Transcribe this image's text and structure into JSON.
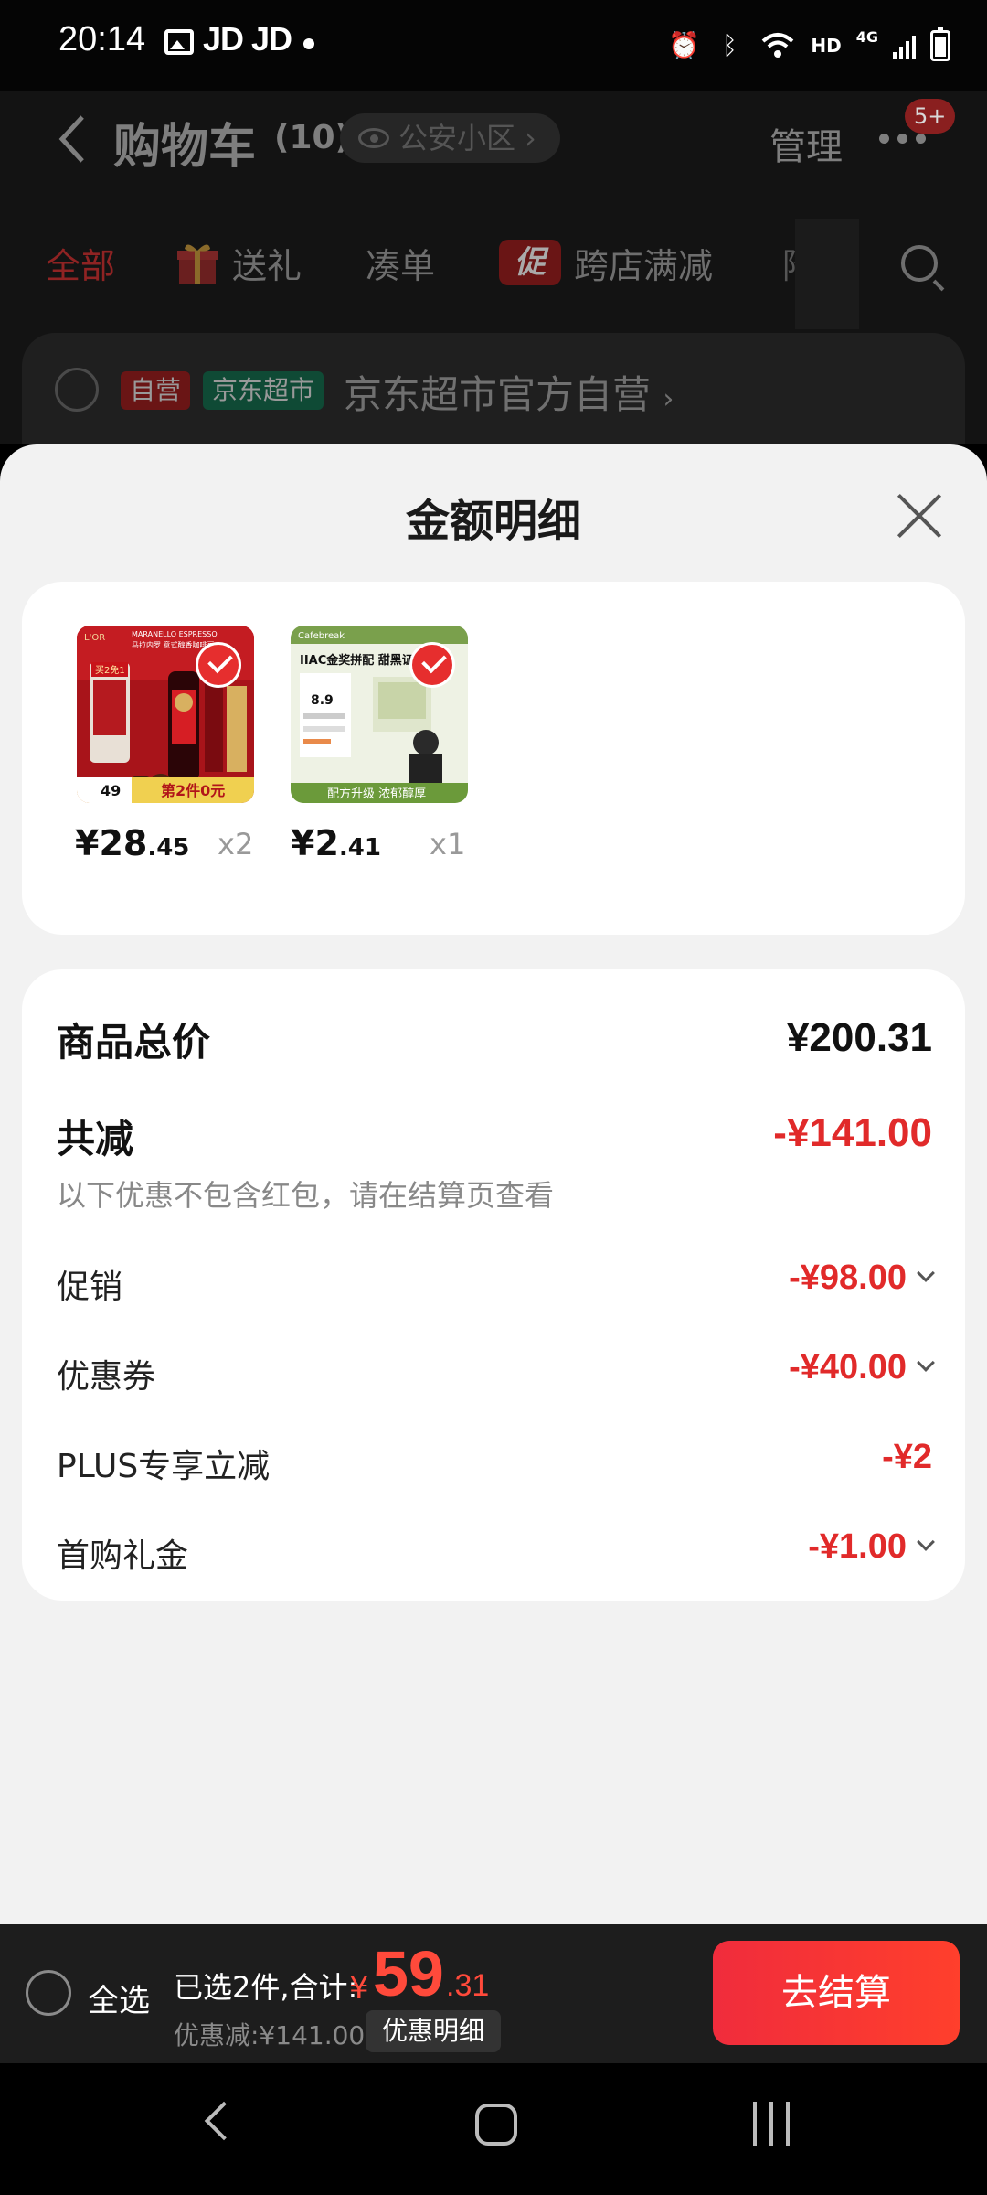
{
  "status_bar": {
    "time": "20:14",
    "apps": "JD JD",
    "hd": "HD",
    "network": "4G"
  },
  "background": {
    "title": "购物车",
    "count": "(10)",
    "location": "公安小区",
    "location_chevron": "›",
    "manage": "管理",
    "badge": "5+",
    "tabs": [
      "全部",
      "送礼",
      "凑单",
      "跨店满减",
      "降价"
    ],
    "promo_icon": "促",
    "store_tags": [
      "自营",
      "京东超市"
    ],
    "store_name": "京东超市官方自营",
    "store_chevron": "›"
  },
  "sheet": {
    "title": "金额明细",
    "products": [
      {
        "name": "coffee-beans-product",
        "price_int": "¥28",
        "price_dec": ".45",
        "qty": "x2"
      },
      {
        "name": "coffee-capsule-product",
        "price_int": "¥2",
        "price_dec": ".41",
        "qty": "x1"
      }
    ],
    "product_images": {
      "p1_brand": "L'OR",
      "p1_title": "MARANELLO ESPRESSO",
      "p1_subtitle": "马拉内罗 意式醇香咖啡豆",
      "p1_tag": "买2免1",
      "p1_price": "49",
      "p1_banner": "第2件0元",
      "p2_brand": "Cafebreak",
      "p2_title": "IIAC金奖拼配 甜黑证",
      "p2_price": "8.9",
      "p2_banner": "配方升级 浓郁醇厚"
    },
    "summary": {
      "total_label": "商品总价",
      "total_value": "¥200.31",
      "reduce_label": "共减",
      "reduce_value": "-¥141.00",
      "note": "以下优惠不包含红包，请在结算页查看",
      "items": [
        {
          "label": "促销",
          "value": "-¥98.00",
          "expandable": true
        },
        {
          "label": "优惠券",
          "value": "-¥40.00",
          "expandable": true
        },
        {
          "label": "PLUS专享立减",
          "value": "-¥2",
          "expandable": false
        },
        {
          "label": "首购礼金",
          "value": "-¥1.00",
          "expandable": true
        }
      ]
    }
  },
  "checkout": {
    "select_all": "全选",
    "selected_text": "已选2件,合计:",
    "currency": "¥",
    "total_int": "59",
    "total_dec": ".31",
    "discount_text": "优惠减:¥141.00",
    "detail_button": "优惠明细",
    "checkout_button": "去结算"
  },
  "colors": {
    "accent_red": "#e12a2a",
    "checkout_red": "#ff3f2c",
    "promo_green": "#16a36e"
  }
}
